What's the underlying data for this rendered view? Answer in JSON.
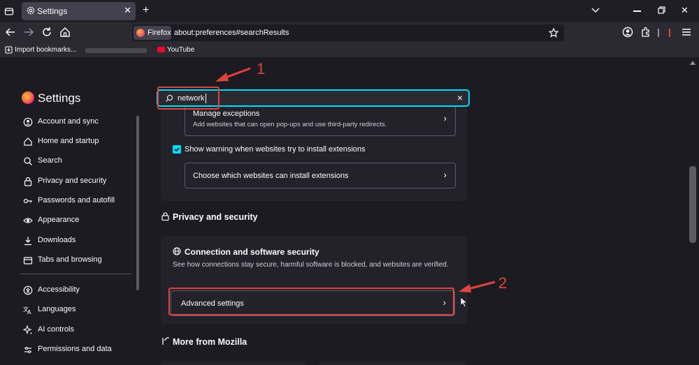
{
  "browser": {
    "tab_title": "Settings",
    "identity_label": "Firefox",
    "url": "about:preferences#searchResults",
    "bookmarks": [
      {
        "label": "Import bookmarks..."
      },
      {
        "label": "YouTube"
      }
    ]
  },
  "sidebar": {
    "title": "Settings",
    "items": [
      {
        "label": "Account and sync",
        "icon": "account-icon"
      },
      {
        "label": "Home and startup",
        "icon": "home-icon"
      },
      {
        "label": "Search",
        "icon": "search-icon"
      },
      {
        "label": "Privacy and security",
        "icon": "lock-icon"
      },
      {
        "label": "Passwords and autofill",
        "icon": "key-icon"
      },
      {
        "label": "Appearance",
        "icon": "eye-icon"
      },
      {
        "label": "Downloads",
        "icon": "download-icon"
      },
      {
        "label": "Tabs and browsing",
        "icon": "tabs-icon"
      },
      {
        "label": "Accessibility",
        "icon": "accessibility-icon"
      },
      {
        "label": "Languages",
        "icon": "languages-icon"
      },
      {
        "label": "AI controls",
        "icon": "ai-icon"
      },
      {
        "label": "Permissions and data",
        "icon": "permissions-icon"
      }
    ]
  },
  "search": {
    "value": "network"
  },
  "extensions_card": {
    "manage_exceptions_title": "Manage exceptions",
    "manage_exceptions_desc": "Add websites that can open pop-ups and use third-party redirects.",
    "warning_checkbox_label": "Show warning when websites try to install extensions",
    "warning_checked": true,
    "choose_websites_label": "Choose which websites can install extensions"
  },
  "privacy_section": {
    "heading": "Privacy and security",
    "card_title": "Connection and software security",
    "card_desc": "See how connections stay secure, harmful software is blocked, and websites are verified.",
    "advanced_label": "Advanced settings"
  },
  "more_section": {
    "heading": "More from Mozilla"
  },
  "annotations": {
    "label_1": "1",
    "label_2": "2",
    "color": "#e0443c"
  },
  "colors": {
    "accent": "#00ddff",
    "background": "#1c1b22",
    "card": "#23222b"
  }
}
